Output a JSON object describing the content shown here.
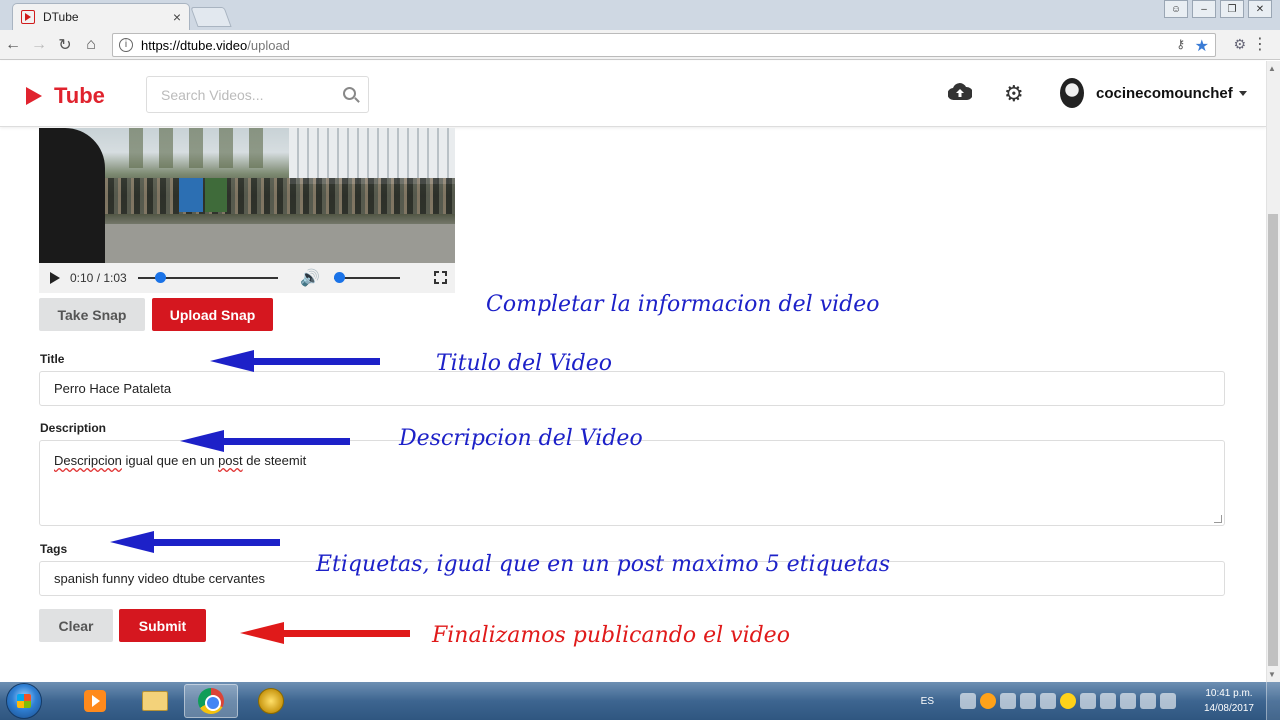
{
  "browser": {
    "tab_title": "DTube",
    "tab_close": "×",
    "url_host": "https://dtube.video",
    "url_path": "/upload"
  },
  "header": {
    "logo_text": "Tube",
    "search_placeholder": "Search Videos...",
    "username": "cocinecomounchef"
  },
  "player": {
    "time": "0:10 / 1:03",
    "progress_fraction": 0.159
  },
  "snap": {
    "take_label": "Take Snap",
    "upload_label": "Upload Snap"
  },
  "form": {
    "title_label": "Title",
    "title_value": "Perro Hace Pataleta",
    "description_label": "Description",
    "description_word1": "Descripcion",
    "description_mid": " igual que en un ",
    "description_word2": "post",
    "description_end": " de steemit",
    "tags_label": "Tags",
    "tags_value": "spanish funny video dtube cervantes",
    "clear_label": "Clear",
    "submit_label": "Submit"
  },
  "annotations": {
    "heading": "Completar la informacion del video",
    "title_note": "Titulo del Video",
    "description_note": "Descripcion del Video",
    "tags_note": "Etiquetas, igual que en un post maximo 5 etiquetas",
    "submit_note": "Finalizamos publicando el video"
  },
  "colors": {
    "brand_red": "#d5171f",
    "annotation_blue": "#1d21c8",
    "annotation_red": "#e01a1a"
  },
  "taskbar": {
    "language": "ES",
    "time": "10:41 p.m.",
    "date": "14/08/2017"
  }
}
